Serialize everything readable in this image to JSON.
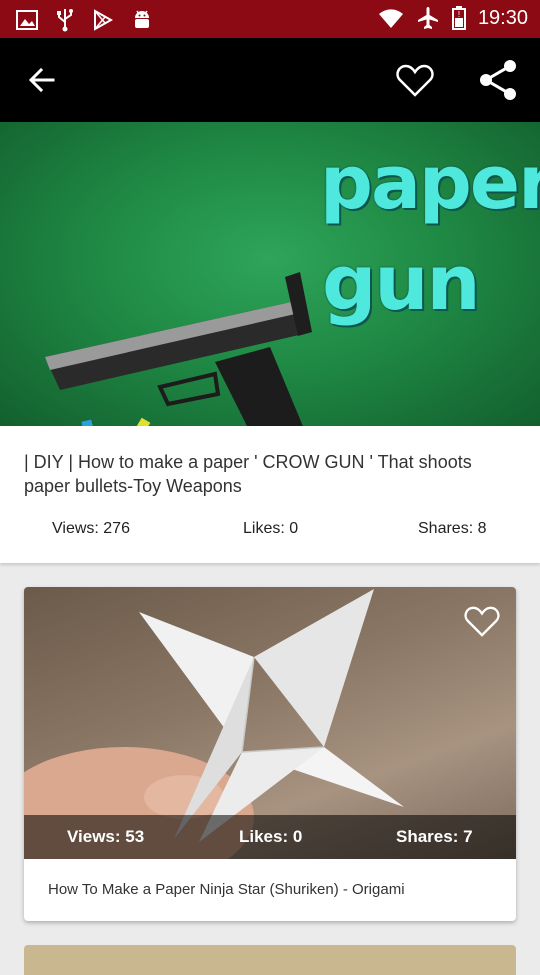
{
  "status_bar": {
    "time": "19:30",
    "left_icons": [
      "image-icon",
      "usb-icon",
      "play-store-icon",
      "android-icon"
    ],
    "right_icons": [
      "wifi-icon",
      "airplane-icon",
      "battery-icon"
    ]
  },
  "toolbar": {
    "back_icon": "arrow-back-icon",
    "favorite_icon": "heart-outline-icon",
    "share_icon": "share-icon"
  },
  "hero": {
    "line1": "paper",
    "line2": "gun"
  },
  "video": {
    "title": "| DIY | How to make a paper ' CROW GUN ' That shoots paper bullets-Toy Weapons",
    "views": "Views: 276",
    "likes": "Likes: 0",
    "shares": "Shares: 8"
  },
  "related": [
    {
      "title": "How To Make a Paper Ninja Star (Shuriken) - Origami",
      "views": "Views: 53",
      "likes": "Likes: 0",
      "shares": "Shares: 7"
    }
  ],
  "colors": {
    "status_bar": "#8c0a14",
    "toolbar": "#000000",
    "hero_text": "#4ee8dc",
    "background": "#ebebeb"
  }
}
